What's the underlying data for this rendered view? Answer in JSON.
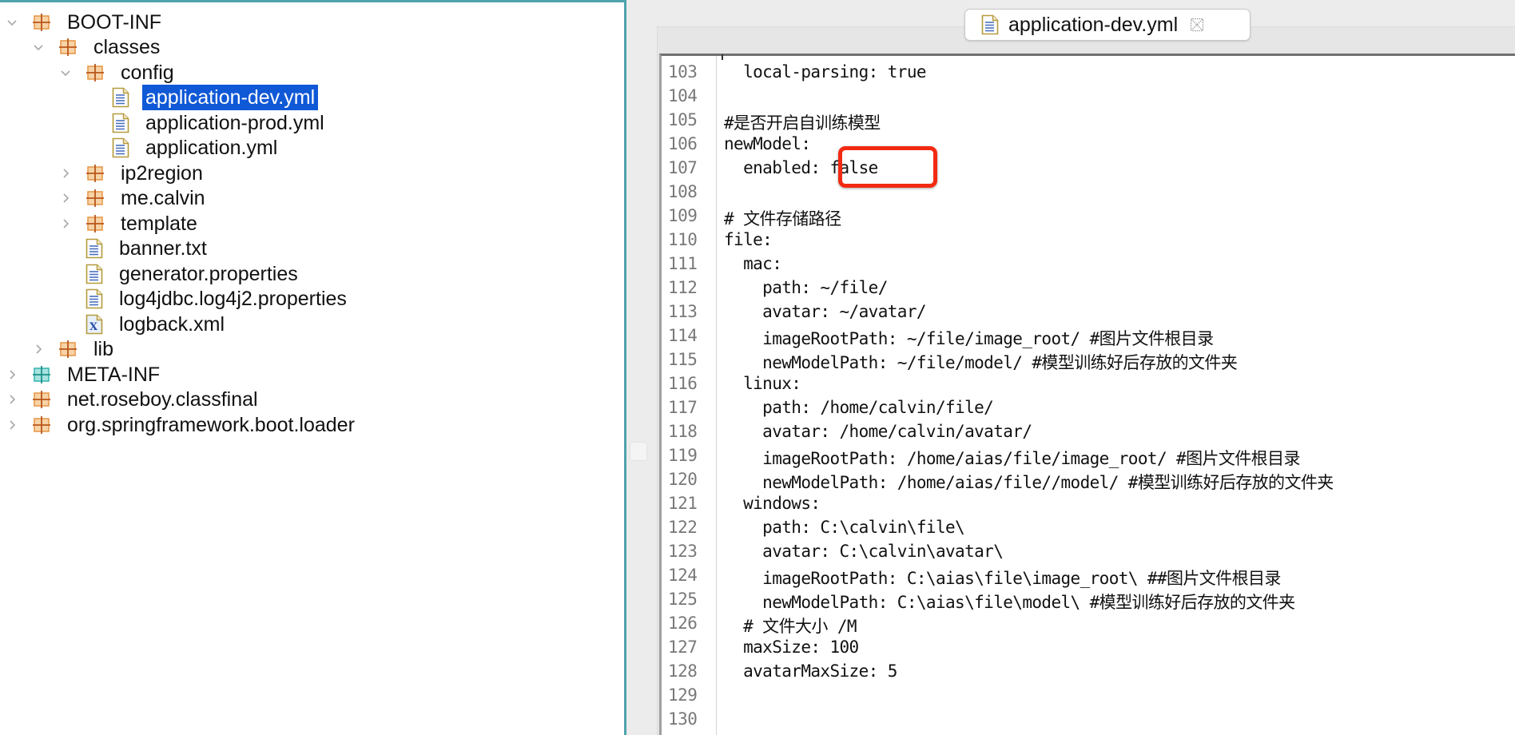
{
  "tree": {
    "items": [
      {
        "label": "BOOT-INF",
        "icon": "package-folder-icon",
        "expanded": true,
        "level": 0,
        "twisty": "expanded"
      },
      {
        "label": "classes",
        "icon": "package-folder-icon",
        "expanded": true,
        "level": 1,
        "twisty": "expanded"
      },
      {
        "label": "config",
        "icon": "package-folder-icon",
        "expanded": true,
        "level": 2,
        "twisty": "expanded"
      },
      {
        "label": "application-dev.yml",
        "icon": "text-file-icon",
        "level": 3,
        "twisty": "none",
        "selected": true
      },
      {
        "label": "application-prod.yml",
        "icon": "text-file-icon",
        "level": 3,
        "twisty": "none"
      },
      {
        "label": "application.yml",
        "icon": "text-file-icon",
        "level": 3,
        "twisty": "none"
      },
      {
        "label": "ip2region",
        "icon": "package-folder-icon",
        "level": 2,
        "twisty": "collapsed"
      },
      {
        "label": "me.calvin",
        "icon": "package-folder-icon",
        "level": 2,
        "twisty": "collapsed"
      },
      {
        "label": "template",
        "icon": "package-folder-icon",
        "level": 2,
        "twisty": "collapsed"
      },
      {
        "label": "banner.txt",
        "icon": "text-file-icon",
        "level": 2,
        "twisty": "none"
      },
      {
        "label": "generator.properties",
        "icon": "text-file-icon",
        "level": 2,
        "twisty": "none"
      },
      {
        "label": "log4jdbc.log4j2.properties",
        "icon": "text-file-icon",
        "level": 2,
        "twisty": "none"
      },
      {
        "label": "logback.xml",
        "icon": "xml-file-icon",
        "level": 2,
        "twisty": "none"
      },
      {
        "label": "lib",
        "icon": "package-folder-icon",
        "level": 1,
        "twisty": "collapsed"
      },
      {
        "label": "META-INF",
        "icon": "meta-folder-icon",
        "level": 0,
        "twisty": "collapsed"
      },
      {
        "label": "net.roseboy.classfinal",
        "icon": "package-folder-icon",
        "level": 0,
        "twisty": "collapsed"
      },
      {
        "label": "org.springframework.boot.loader",
        "icon": "package-folder-icon",
        "level": 0,
        "twisty": "collapsed"
      }
    ]
  },
  "editor": {
    "tab": {
      "title": "application-dev.yml",
      "icon": "text-file-icon",
      "close_icon": "close-icon"
    },
    "highlight_color": "#f22a12",
    "highlighted_line": 107,
    "lines": [
      {
        "num": "103",
        "text": "  local-parsing: true"
      },
      {
        "num": "104",
        "text": ""
      },
      {
        "num": "105",
        "text": "#是否开启自训练模型"
      },
      {
        "num": "106",
        "text": "newModel:"
      },
      {
        "num": "107",
        "text": "  enabled: false"
      },
      {
        "num": "108",
        "text": ""
      },
      {
        "num": "109",
        "text": "# 文件存储路径"
      },
      {
        "num": "110",
        "text": "file:"
      },
      {
        "num": "111",
        "text": "  mac:"
      },
      {
        "num": "112",
        "text": "    path: ~/file/"
      },
      {
        "num": "113",
        "text": "    avatar: ~/avatar/"
      },
      {
        "num": "114",
        "text": "    imageRootPath: ~/file/image_root/ #图片文件根目录"
      },
      {
        "num": "115",
        "text": "    newModelPath: ~/file/model/ #模型训练好后存放的文件夹"
      },
      {
        "num": "116",
        "text": "  linux:"
      },
      {
        "num": "117",
        "text": "    path: /home/calvin/file/"
      },
      {
        "num": "118",
        "text": "    avatar: /home/calvin/avatar/"
      },
      {
        "num": "119",
        "text": "    imageRootPath: /home/aias/file/image_root/ #图片文件根目录"
      },
      {
        "num": "120",
        "text": "    newModelPath: /home/aias/file//model/ #模型训练好后存放的文件夹"
      },
      {
        "num": "121",
        "text": "  windows:"
      },
      {
        "num": "122",
        "text": "    path: C:\\calvin\\file\\"
      },
      {
        "num": "123",
        "text": "    avatar: C:\\calvin\\avatar\\"
      },
      {
        "num": "124",
        "text": "    imageRootPath: C:\\aias\\file\\image_root\\ ##图片文件根目录"
      },
      {
        "num": "125",
        "text": "    newModelPath: C:\\aias\\file\\model\\ #模型训练好后存放的文件夹"
      },
      {
        "num": "126",
        "text": "  # 文件大小 /M"
      },
      {
        "num": "127",
        "text": "  maxSize: 100"
      },
      {
        "num": "128",
        "text": "  avatarMaxSize: 5"
      },
      {
        "num": "129",
        "text": ""
      },
      {
        "num": "130",
        "text": ""
      }
    ]
  }
}
